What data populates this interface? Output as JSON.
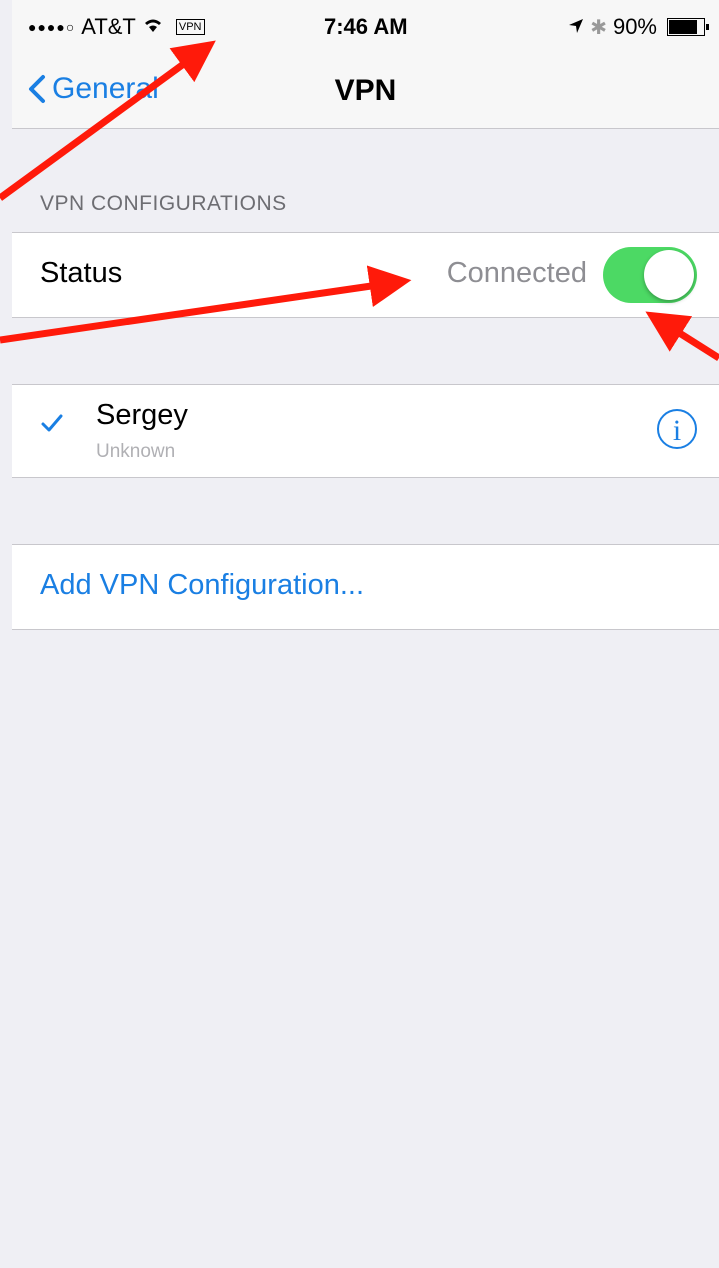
{
  "status_bar": {
    "carrier": "AT&T",
    "vpn_badge": "VPN",
    "time": "7:46 AM",
    "battery": "90%"
  },
  "nav": {
    "back_label": "General",
    "title": "VPN"
  },
  "section_header": "VPN CONFIGURATIONS",
  "status_row": {
    "label": "Status",
    "value": "Connected",
    "toggle_on": true
  },
  "config": {
    "name": "Sergey",
    "subtitle": "Unknown",
    "selected": true
  },
  "add_config_label": "Add VPN Configuration...",
  "colors": {
    "accent": "#1a7fe3",
    "toggle_on": "#4cd964",
    "annotation_arrow": "#ff1a0a"
  }
}
